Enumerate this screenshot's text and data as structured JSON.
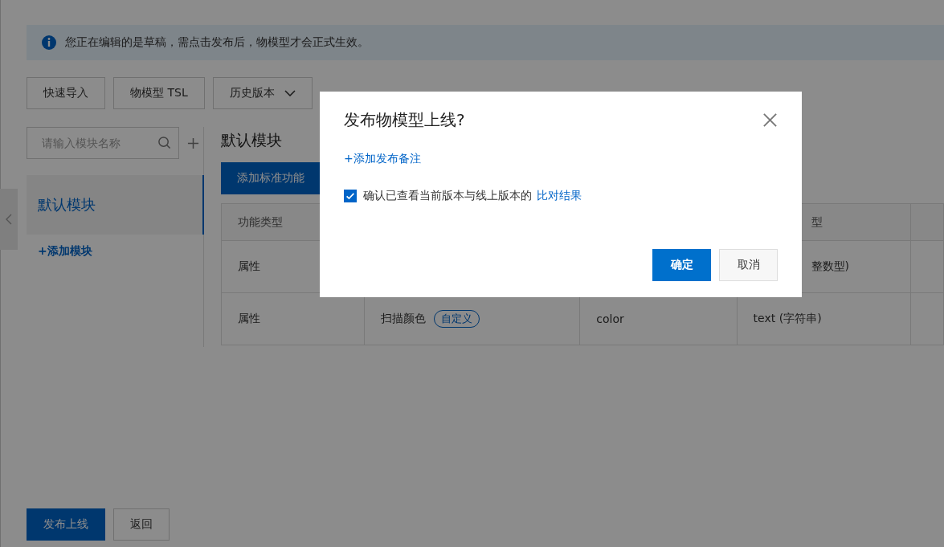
{
  "notice": {
    "text": "您正在编辑的是草稿，需点击发布后，物模型才会正式生效。"
  },
  "toolbar": [
    {
      "label": "快速导入",
      "kind": "plain"
    },
    {
      "label": "物模型 TSL",
      "kind": "plain"
    },
    {
      "label": "历史版本",
      "kind": "dropdown"
    }
  ],
  "module_search": {
    "placeholder": "请输入模块名称"
  },
  "modules": [
    {
      "label": "默认模块",
      "selected": true
    }
  ],
  "add_module": "+添加模块",
  "module_title": "默认模块",
  "add_standard_button": "添加标准功能",
  "table": {
    "columns": [
      "功能类型",
      "",
      "",
      "型"
    ],
    "rows": [
      {
        "cells": [
          "属性",
          "",
          "",
          "整数型)"
        ],
        "tag": ""
      },
      {
        "cells": [
          "属性",
          "扫描颜色",
          "color",
          "text (字符串)"
        ],
        "tag": "自定义"
      }
    ]
  },
  "footer_buttons": [
    {
      "label": "发布上线",
      "kind": "primary"
    },
    {
      "label": "返回",
      "kind": "normal"
    }
  ],
  "dialog": {
    "title": "发布物模型上线?",
    "add_note_link": "+添加发布备注",
    "confirm_checkbox": {
      "checked": true,
      "label": "确认已查看当前版本与线上版本的",
      "link": "比对结果"
    },
    "buttons": [
      {
        "label": "确定",
        "kind": "primary"
      },
      {
        "label": "取消",
        "kind": "normal"
      }
    ]
  }
}
